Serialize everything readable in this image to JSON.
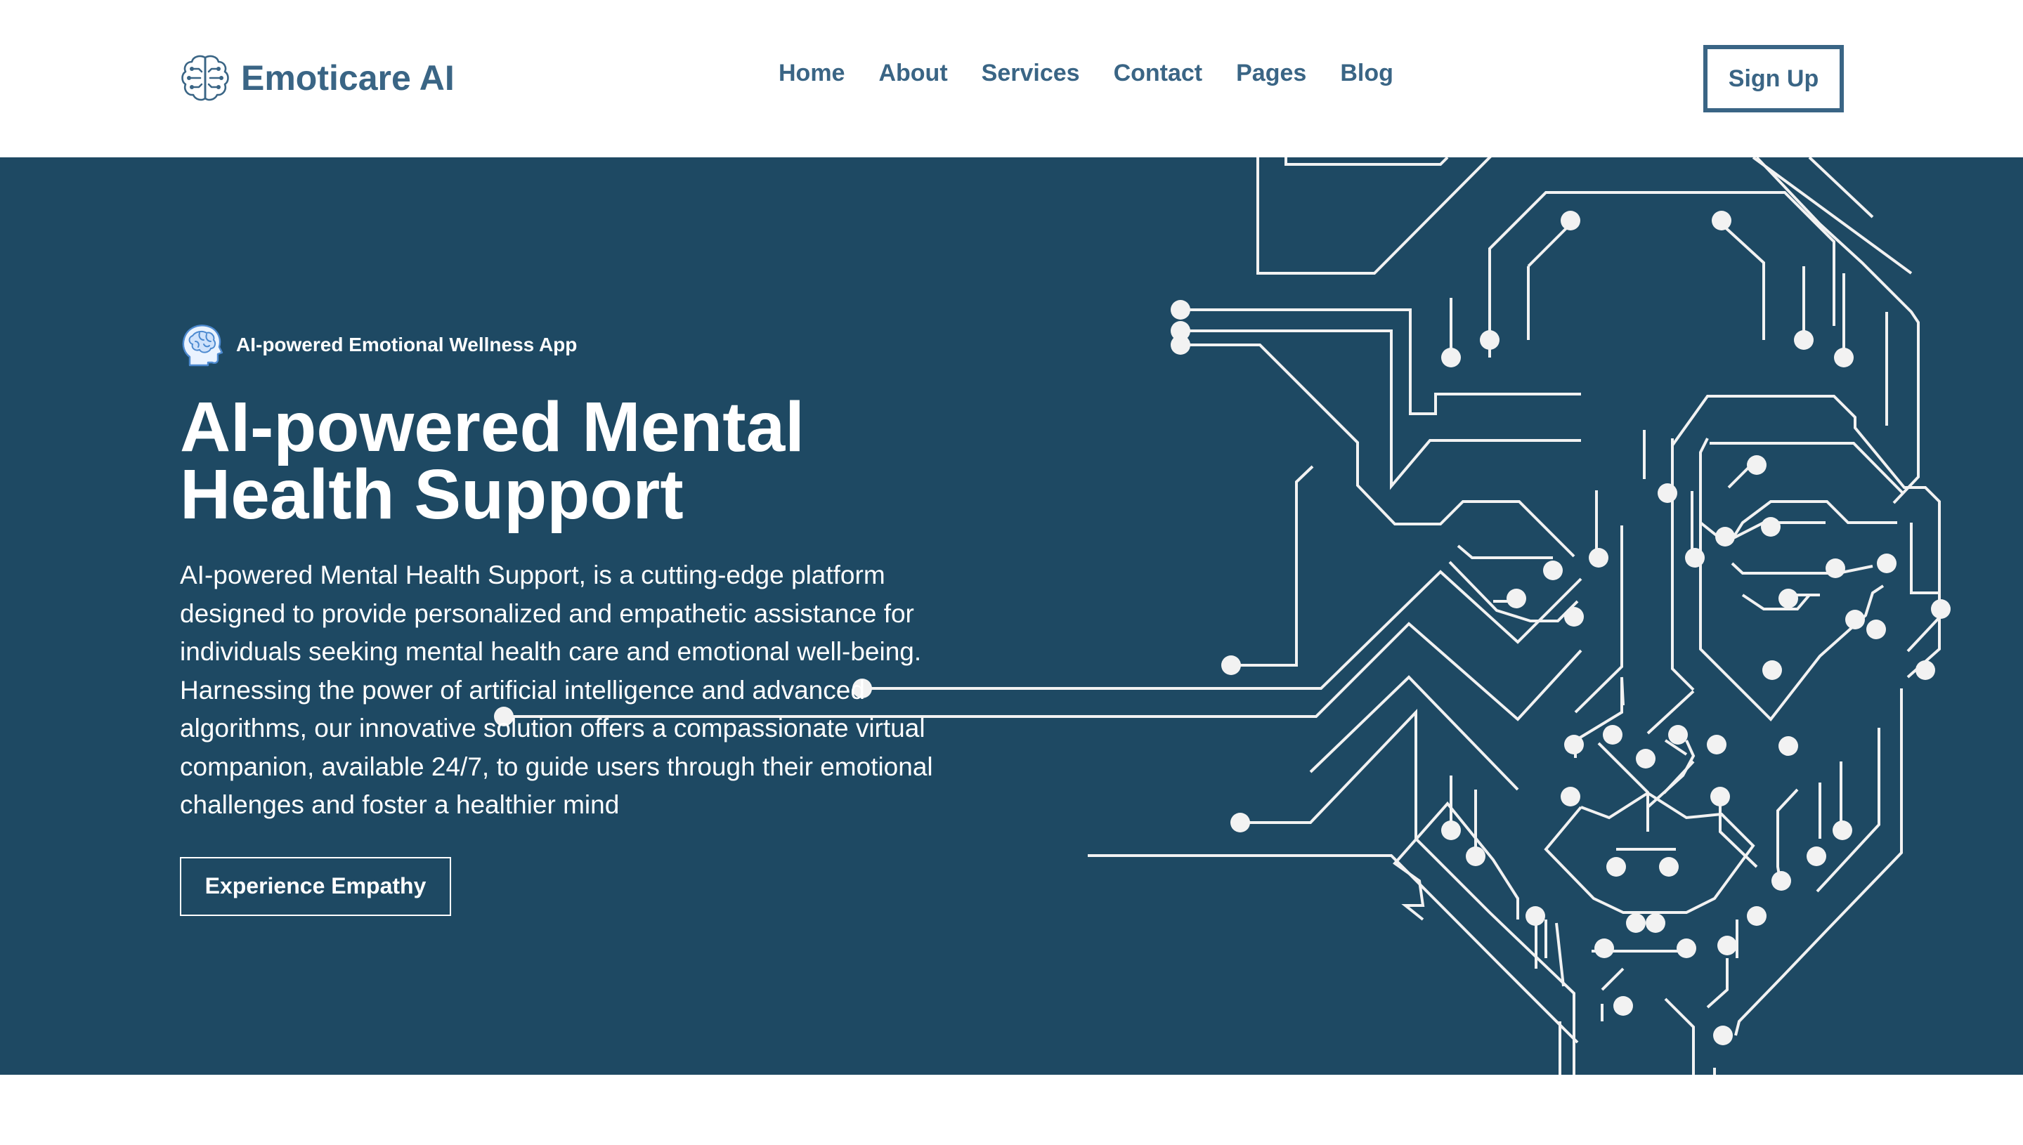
{
  "brand": {
    "name": "Emoticare AI",
    "icon": "brain-circuit-icon"
  },
  "nav": {
    "items": [
      {
        "label": "Home"
      },
      {
        "label": "About"
      },
      {
        "label": "Services"
      },
      {
        "label": "Contact"
      },
      {
        "label": "Pages"
      },
      {
        "label": "Blog"
      }
    ],
    "signup_label": "Sign Up"
  },
  "hero": {
    "tagline": "AI-powered Emotional Wellness App",
    "tagline_icon": "head-brain-icon",
    "title": "AI-powered Mental Health Support",
    "description": "AI-powered Mental Health Support, is a cutting-edge platform designed to provide personalized and empathetic assistance for individuals seeking mental health care and emotional well-being. Harnessing the power of artificial intelligence and advanced algorithms, our innovative solution offers a compassionate virtual companion, available 24/7, to guide users through their emotional challenges and foster a healthier mind",
    "cta_label": "Experience Empathy",
    "illustration": "circuit-face-illustration"
  },
  "colors": {
    "brand": "#3a6585",
    "hero_background": "#1e4963",
    "circuit_line": "#f2f2f2",
    "text_on_dark": "#ffffff"
  }
}
